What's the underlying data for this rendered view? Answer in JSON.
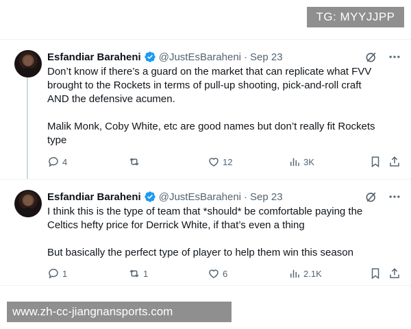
{
  "watermarks": {
    "top": "TG: MYYJJPP",
    "bottom": "www.zh-cc-jiangnansports.com"
  },
  "colors": {
    "verified_badge": "#1d9bf0",
    "text_primary": "#0f1419",
    "text_secondary": "#536471",
    "thread_line": "#cfd9de",
    "watermark_bg": "#8f8f8f"
  },
  "tweets": [
    {
      "author_name": "Esfandiar Baraheni",
      "handle": "@JustEsBaraheni",
      "separator": "·",
      "date": "Sep 23",
      "verified": true,
      "text": "Don’t know if there’s a guard on the market that can replicate what FVV\nbrought to the Rockets in terms of pull-up shooting, pick-and-roll craft\nAND the defensive acumen.\n\nMalik Monk, Coby White, etc are good names but don’t really fit Rockets\ntype",
      "replies": "4",
      "retweets": "",
      "likes": "12",
      "views": "3K",
      "icons": [
        "reply-icon",
        "retweet-icon",
        "like-icon",
        "views-icon",
        "bookmark-icon",
        "share-icon",
        "grok-icon",
        "more-icon"
      ]
    },
    {
      "author_name": "Esfandiar Baraheni",
      "handle": "@JustEsBaraheni",
      "separator": "·",
      "date": "Sep 23",
      "verified": true,
      "text": "I think this is the type of team that *should* be comfortable paying the\nCeltics hefty price for Derrick White, if that’s even a thing\n\nBut basically the perfect type of player to help them win this season",
      "replies": "1",
      "retweets": "1",
      "likes": "6",
      "views": "2.1K",
      "icons": [
        "reply-icon",
        "retweet-icon",
        "like-icon",
        "views-icon",
        "bookmark-icon",
        "share-icon",
        "grok-icon",
        "more-icon"
      ]
    }
  ]
}
